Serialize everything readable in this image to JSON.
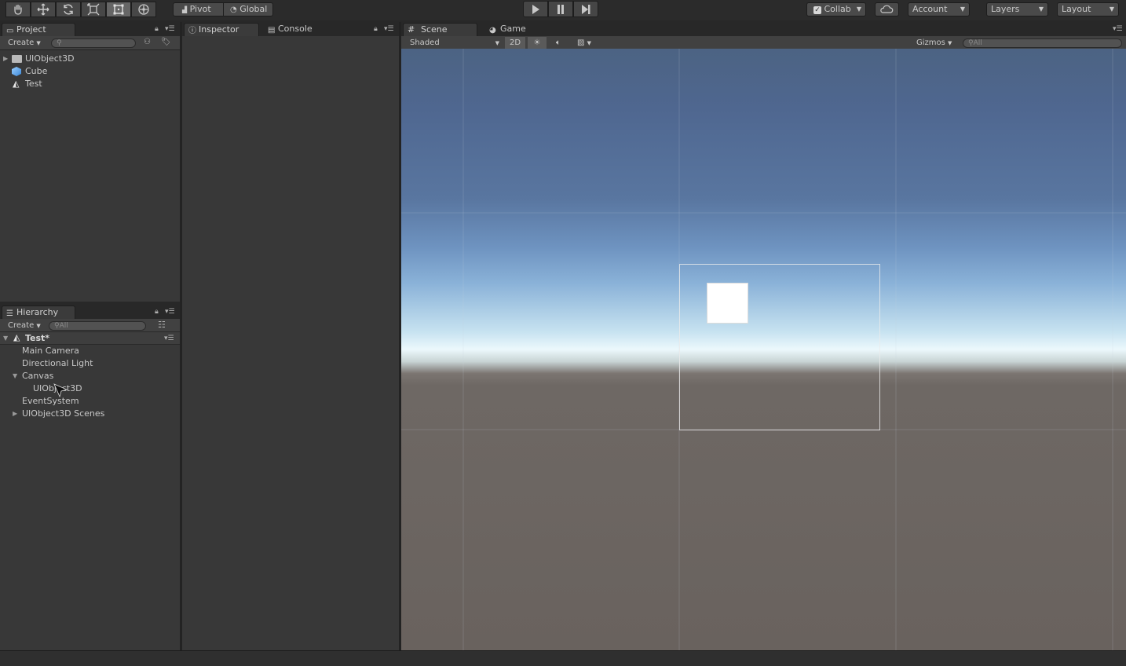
{
  "toolbar": {
    "pivot_label": "Pivot",
    "global_label": "Global",
    "collab_label": "Collab",
    "account_label": "Account",
    "layers_label": "Layers",
    "layout_label": "Layout"
  },
  "project": {
    "tab_label": "Project",
    "create_label": "Create",
    "items": [
      "UIObject3D",
      "Cube",
      "Test"
    ]
  },
  "hierarchy": {
    "tab_label": "Hierarchy",
    "create_label": "Create",
    "search_placeholder": "All",
    "scene_name": "Test*",
    "items": [
      "Main Camera",
      "Directional Light",
      "Canvas",
      "UIObject3D",
      "EventSystem",
      "UIObject3D Scenes"
    ]
  },
  "inspector": {
    "tab_label": "Inspector",
    "console_tab_label": "Console"
  },
  "scene": {
    "scene_tab_label": "Scene",
    "game_tab_label": "Game",
    "shading_mode": "Shaded",
    "twod_label": "2D",
    "gizmos_label": "Gizmos",
    "search_placeholder": "All"
  }
}
